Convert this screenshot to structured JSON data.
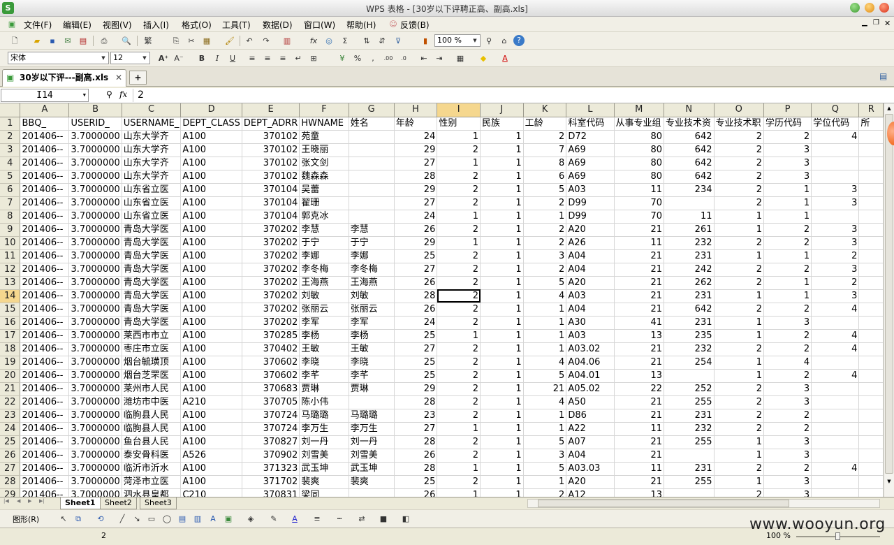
{
  "window": {
    "title": "WPS 表格 - [30岁以下评聘正高、副高.xls]"
  },
  "menu": [
    "文件(F)",
    "编辑(E)",
    "视图(V)",
    "插入(I)",
    "格式(O)",
    "工具(T)",
    "数据(D)",
    "窗口(W)",
    "帮助(H)",
    "反馈(B)"
  ],
  "toolbar": {
    "zoom": "100 %",
    "font_name": "宋体",
    "font_size": "12",
    "percent": "%"
  },
  "doc_tab": {
    "label": "30岁以下评---副高.xls"
  },
  "formula_bar": {
    "cell_ref": "I14",
    "fx": "fx",
    "value": "2"
  },
  "grid": {
    "columns": [
      "A",
      "B",
      "C",
      "D",
      "E",
      "F",
      "G",
      "H",
      "I",
      "J",
      "K",
      "L",
      "M",
      "N",
      "O",
      "P",
      "Q",
      "R"
    ],
    "selected_col": "I",
    "selected_row": "14",
    "rows": [
      {
        "n": "1",
        "c": [
          "BBQ_",
          "USERID_",
          "USERNAME_",
          "DEPT_CLASS",
          "DEPT_ADRR",
          "HWNAME",
          "姓名",
          "年龄",
          "性别",
          "民族",
          "工龄",
          "科室代码",
          "从事专业组",
          "专业技术资",
          "专业技术职",
          "学历代码",
          "学位代码",
          "所"
        ]
      },
      {
        "n": "2",
        "c": [
          "201406--",
          "3.7000000",
          "山东大学齐",
          "A100",
          "370102",
          "苑童",
          "",
          "24",
          "1",
          "1",
          "2",
          "D72",
          "80",
          "642",
          "2",
          "2",
          "4",
          ""
        ]
      },
      {
        "n": "3",
        "c": [
          "201406--",
          "3.7000000",
          "山东大学齐",
          "A100",
          "370102",
          "王晓丽",
          "",
          "29",
          "2",
          "1",
          "7",
          "A69",
          "80",
          "642",
          "2",
          "3",
          "",
          ""
        ]
      },
      {
        "n": "4",
        "c": [
          "201406--",
          "3.7000000",
          "山东大学齐",
          "A100",
          "370102",
          "张文剑",
          "",
          "27",
          "1",
          "1",
          "8",
          "A69",
          "80",
          "642",
          "2",
          "3",
          "",
          ""
        ]
      },
      {
        "n": "5",
        "c": [
          "201406--",
          "3.7000000",
          "山东大学齐",
          "A100",
          "370102",
          "魏森森",
          "",
          "28",
          "2",
          "1",
          "6",
          "A69",
          "80",
          "642",
          "2",
          "3",
          "",
          ""
        ]
      },
      {
        "n": "6",
        "c": [
          "201406--",
          "3.7000000",
          "山东省立医",
          "A100",
          "370104",
          "吴蕾",
          "",
          "29",
          "2",
          "1",
          "5",
          "A03",
          "11",
          "234",
          "2",
          "1",
          "3",
          ""
        ]
      },
      {
        "n": "7",
        "c": [
          "201406--",
          "3.7000000",
          "山东省立医",
          "A100",
          "370104",
          "翟珊",
          "",
          "27",
          "2",
          "1",
          "2",
          "D99",
          "70",
          "",
          "2",
          "1",
          "3",
          ""
        ]
      },
      {
        "n": "8",
        "c": [
          "201406--",
          "3.7000000",
          "山东省立医",
          "A100",
          "370104",
          "郭克冰",
          "",
          "24",
          "1",
          "1",
          "1",
          "D99",
          "70",
          "11",
          "1",
          "1",
          "",
          ""
        ]
      },
      {
        "n": "9",
        "c": [
          "201406--",
          "3.7000000",
          "青岛大学医",
          "A100",
          "370202",
          "李慧",
          "李慧",
          "26",
          "2",
          "1",
          "2",
          "A20",
          "21",
          "261",
          "1",
          "2",
          "3",
          ""
        ]
      },
      {
        "n": "10",
        "c": [
          "201406--",
          "3.7000000",
          "青岛大学医",
          "A100",
          "370202",
          "于宁",
          "于宁",
          "29",
          "1",
          "1",
          "2",
          "A26",
          "11",
          "232",
          "2",
          "2",
          "3",
          ""
        ]
      },
      {
        "n": "11",
        "c": [
          "201406--",
          "3.7000000",
          "青岛大学医",
          "A100",
          "370202",
          "李娜",
          "李娜",
          "25",
          "2",
          "1",
          "3",
          "A04",
          "21",
          "231",
          "1",
          "1",
          "2",
          ""
        ]
      },
      {
        "n": "12",
        "c": [
          "201406--",
          "3.7000000",
          "青岛大学医",
          "A100",
          "370202",
          "李冬梅",
          "李冬梅",
          "27",
          "2",
          "1",
          "2",
          "A04",
          "21",
          "242",
          "2",
          "2",
          "3",
          ""
        ]
      },
      {
        "n": "13",
        "c": [
          "201406--",
          "3.7000000",
          "青岛大学医",
          "A100",
          "370202",
          "王海燕",
          "王海燕",
          "26",
          "2",
          "1",
          "5",
          "A20",
          "21",
          "262",
          "2",
          "1",
          "2",
          ""
        ]
      },
      {
        "n": "14",
        "c": [
          "201406--",
          "3.7000000",
          "青岛大学医",
          "A100",
          "370202",
          "刘敏",
          "刘敏",
          "28",
          "2",
          "1",
          "4",
          "A03",
          "21",
          "231",
          "1",
          "1",
          "3",
          ""
        ]
      },
      {
        "n": "15",
        "c": [
          "201406--",
          "3.7000000",
          "青岛大学医",
          "A100",
          "370202",
          "张丽云",
          "张丽云",
          "26",
          "2",
          "1",
          "1",
          "A04",
          "21",
          "642",
          "2",
          "2",
          "4",
          ""
        ]
      },
      {
        "n": "16",
        "c": [
          "201406--",
          "3.7000000",
          "青岛大学医",
          "A100",
          "370202",
          "李军",
          "李军",
          "24",
          "2",
          "1",
          "1",
          "A30",
          "41",
          "231",
          "1",
          "3",
          "",
          ""
        ]
      },
      {
        "n": "17",
        "c": [
          "201406--",
          "3.7000000",
          "莱西市市立",
          "A100",
          "370285",
          "李杨",
          "李杨",
          "25",
          "1",
          "1",
          "1",
          "A03",
          "13",
          "235",
          "1",
          "2",
          "4",
          ""
        ]
      },
      {
        "n": "18",
        "c": [
          "201406--",
          "3.7000000",
          "枣庄市立医",
          "A100",
          "370402",
          "王敏",
          "王敏",
          "27",
          "2",
          "1",
          "1",
          "A03.02",
          "21",
          "232",
          "2",
          "2",
          "4",
          ""
        ]
      },
      {
        "n": "19",
        "c": [
          "201406--",
          "3.7000000",
          "烟台毓璜顶",
          "A100",
          "370602",
          "李晓",
          "李晓",
          "25",
          "2",
          "1",
          "4",
          "A04.06",
          "21",
          "254",
          "1",
          "4",
          "",
          ""
        ]
      },
      {
        "n": "20",
        "c": [
          "201406--",
          "3.7000000",
          "烟台芝罘医",
          "A100",
          "370602",
          "李芊",
          "李芊",
          "25",
          "2",
          "1",
          "5",
          "A04.01",
          "13",
          "",
          "1",
          "2",
          "4",
          ""
        ]
      },
      {
        "n": "21",
        "c": [
          "201406--",
          "3.7000000",
          "莱州市人民",
          "A100",
          "370683",
          "贾琳",
          "贾琳",
          "29",
          "2",
          "1",
          "21",
          "A05.02",
          "22",
          "252",
          "2",
          "3",
          "",
          ""
        ]
      },
      {
        "n": "22",
        "c": [
          "201406--",
          "3.7000000",
          "潍坊市中医",
          "A210",
          "370705",
          "陈小伟",
          "",
          "28",
          "2",
          "1",
          "4",
          "A50",
          "21",
          "255",
          "2",
          "3",
          "",
          ""
        ]
      },
      {
        "n": "23",
        "c": [
          "201406--",
          "3.7000000",
          "临朐县人民",
          "A100",
          "370724",
          "马璐璐",
          "马璐璐",
          "23",
          "2",
          "1",
          "1",
          "D86",
          "21",
          "231",
          "2",
          "2",
          "",
          ""
        ]
      },
      {
        "n": "24",
        "c": [
          "201406--",
          "3.7000000",
          "临朐县人民",
          "A100",
          "370724",
          "李万生",
          "李万生",
          "27",
          "1",
          "1",
          "1",
          "A22",
          "11",
          "232",
          "2",
          "2",
          "",
          ""
        ]
      },
      {
        "n": "25",
        "c": [
          "201406--",
          "3.7000000",
          "鱼台县人民",
          "A100",
          "370827",
          "刘一丹",
          "刘一丹",
          "28",
          "2",
          "1",
          "5",
          "A07",
          "21",
          "255",
          "1",
          "3",
          "",
          ""
        ]
      },
      {
        "n": "26",
        "c": [
          "201406--",
          "3.7000000",
          "泰安骨科医",
          "A526",
          "370902",
          "刘雪美",
          "刘雪美",
          "26",
          "2",
          "1",
          "3",
          "A04",
          "21",
          "",
          "1",
          "3",
          "",
          ""
        ]
      },
      {
        "n": "27",
        "c": [
          "201406--",
          "3.7000000",
          "临沂市沂水",
          "A100",
          "371323",
          "武玉坤",
          "武玉坤",
          "28",
          "1",
          "1",
          "5",
          "A03.03",
          "11",
          "231",
          "2",
          "2",
          "4",
          ""
        ]
      },
      {
        "n": "28",
        "c": [
          "201406--",
          "3.7000000",
          "菏泽市立医",
          "A100",
          "371702",
          "裴爽",
          "裴爽",
          "25",
          "2",
          "1",
          "1",
          "A20",
          "21",
          "255",
          "1",
          "3",
          "",
          ""
        ]
      },
      {
        "n": "29",
        "c": [
          "201406--",
          "3.7000000",
          "泗水县皇都",
          "C210",
          "370831",
          "梁同",
          "",
          "26",
          "1",
          "1",
          "2",
          "A12",
          "13",
          "",
          "2",
          "3",
          "",
          ""
        ]
      }
    ]
  },
  "sheets": [
    "Sheet1",
    "Sheet2",
    "Sheet3"
  ],
  "drawbar": {
    "shapes_label": "图形(R)"
  },
  "status": {
    "value": "2",
    "zoom": "100 %"
  },
  "watermark": "www.wooyun.org"
}
